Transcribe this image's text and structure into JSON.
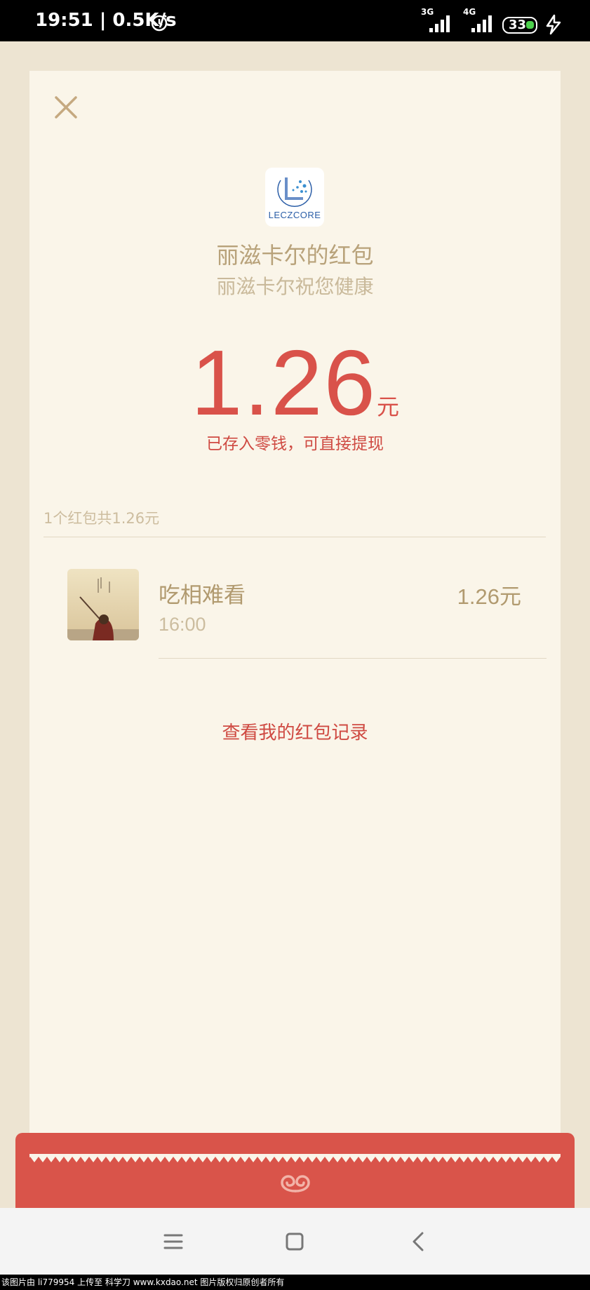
{
  "status_bar": {
    "time": "19:51",
    "speed": "0.5K/s",
    "net1": "3G",
    "net2": "4G",
    "battery": "33",
    "icons": [
      "alarm-icon",
      "signal-icon",
      "battery-icon",
      "charging-icon"
    ]
  },
  "envelope": {
    "logo_text": "LECZCORE",
    "title": "丽滋卡尔的红包",
    "subtitle": "丽滋卡尔祝您健康",
    "amount": "1.26",
    "unit": "元",
    "note": "已存入零钱，可直接提现",
    "summary": "1个红包共1.26元"
  },
  "receivers": [
    {
      "name": "吃相难看",
      "time": "16:00",
      "amount": "1.26元"
    }
  ],
  "records_link": "查看我的红包记录",
  "footer": "该图片由 li779954 上传至 科学刀 www.kxdao.net 图片版权归原创者所有",
  "colors": {
    "accent_red": "#d9524a",
    "gold_text": "#b8a27a",
    "card_bg": "#faf5e9",
    "page_bg": "#ede4d2"
  }
}
